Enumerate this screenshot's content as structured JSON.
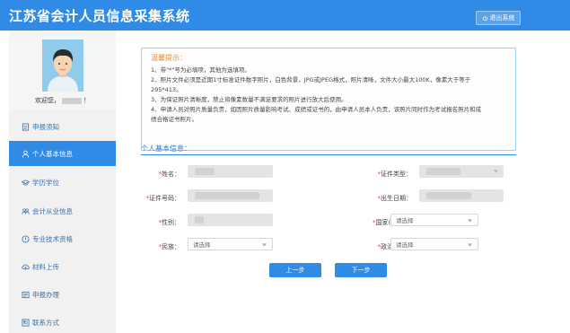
{
  "header": {
    "title": "江苏省会计人员信息采集系统",
    "logout_label": "退出系统"
  },
  "sidebar": {
    "welcome": "欢迎您，",
    "welcome_suffix": "！",
    "items": [
      {
        "label": "申报须知",
        "icon": "document-icon"
      },
      {
        "label": "个人基本信息",
        "icon": "person-icon"
      },
      {
        "label": "学历学位",
        "icon": "graduation-cap-icon"
      },
      {
        "label": "会计从业信息",
        "icon": "people-icon"
      },
      {
        "label": "专业技术资格",
        "icon": "badge-icon"
      },
      {
        "label": "材料上传",
        "icon": "cloud-upload-icon"
      },
      {
        "label": "申报办理",
        "icon": "form-icon"
      },
      {
        "label": "联系方式",
        "icon": "contact-card-icon"
      }
    ]
  },
  "notice": {
    "title": "温馨提示：",
    "items": [
      "1、带\"*\"号为必填项，其他为选填项。",
      "2、照片文件必须是近期1寸标准证件数字照片，白色背景，JPG或JPEG格式，照片清晰，文件大小最大100K，像素大于等于",
      "295*413。",
      "3、为保证照片清晰度，禁止将像素数量不满足要求的照片进行放大后使用。",
      "4、申请人员对照片质量负责，如因照片质量影响考试、成绩或证书的，由申请人员本人负责，该照片同时作为考试报名照片和成",
      "绩合格证书照片。"
    ]
  },
  "form": {
    "section_title": "个人基本信息：",
    "name_label": "姓名：",
    "id_type_label": "证件类型：",
    "id_number_label": "证件号码：",
    "birth_label": "出生日期：",
    "gender_label": "性别：",
    "country_label": "国家(地区)：",
    "country_placeholder": "请选择",
    "ethnicity_label": "民族：",
    "ethnicity_placeholder": "请选择",
    "political_label": "政治面貌：",
    "political_placeholder": "请选择",
    "required_mark": "*"
  },
  "buttons": {
    "prev": "上一步",
    "next": "下一步"
  },
  "colors": {
    "header_blue": "#2f8be5",
    "notice_title": "#f08b2d",
    "required": "#e03b3b"
  }
}
